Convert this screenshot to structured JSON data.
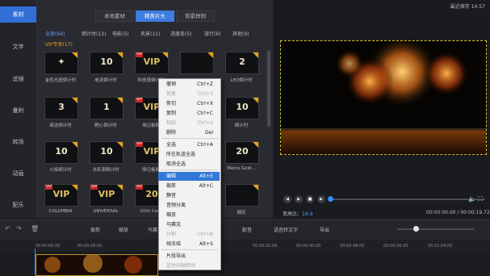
{
  "rail": {
    "items": [
      "素材",
      "文字",
      "滤镜",
      "叠附",
      "转场",
      "动画",
      "配乐"
    ]
  },
  "media": {
    "tabs": [
      "本地素材",
      "精美片头",
      "背景样例"
    ],
    "categories": [
      "全部(64)",
      "倒计时(13)",
      "电影(5)",
      "风景(11)",
      "进度条(5)",
      "旅行(6)",
      "其他(9)"
    ],
    "vip_label": "VIP专享(17)",
    "thumbnails": [
      {
        "label": "金色光斑倒计时",
        "glyph": "✦",
        "vip": false
      },
      {
        "label": "电流倒计时",
        "glyph": "10",
        "vip": false
      },
      {
        "label": "科技感倒计时",
        "glyph": "VIP",
        "vip": true
      },
      {
        "label": "",
        "glyph": "",
        "vip": false
      },
      {
        "label": "LED倒计时",
        "glyph": "2",
        "vip": false
      },
      {
        "label": "简洁倒计时",
        "glyph": "3",
        "vip": false
      },
      {
        "label": "靶心倒计时",
        "glyph": "1",
        "vip": false
      },
      {
        "label": "场记板倒",
        "glyph": "VIP",
        "vip": true
      },
      {
        "label": "",
        "glyph": "",
        "vip": false
      },
      {
        "label": "倒计时",
        "glyph": "10",
        "vip": false
      },
      {
        "label": "火焰倒计时",
        "glyph": "10",
        "vip": false
      },
      {
        "label": "水彩滴倒计时",
        "glyph": "10",
        "vip": false
      },
      {
        "label": "场记板倒",
        "glyph": "VIP",
        "vip": true
      },
      {
        "label": "",
        "glyph": "",
        "vip": false
      },
      {
        "label": "Metro Gold...",
        "glyph": "20",
        "vip": false
      },
      {
        "label": "COLUMBIA",
        "glyph": "VIP",
        "vip": true
      },
      {
        "label": "UNIVERSAL",
        "glyph": "VIP",
        "vip": true
      },
      {
        "label": "20th Cent",
        "glyph": "20",
        "vip": true
      },
      {
        "label": "",
        "glyph": "",
        "vip": false
      },
      {
        "label": "烟花",
        "glyph": "",
        "vip": false
      }
    ]
  },
  "preview": {
    "autosave": "最近保存 14:57",
    "aspect": "宽高比：",
    "aspect_value": "16:9",
    "time": "00:00:00.00 / 00:00:19.72",
    "progress": 0.0
  },
  "timeline": {
    "tools": [
      "裁剪",
      "缩放",
      "马赛克",
      "配音",
      "语音转文字",
      "导出"
    ],
    "ticks": [
      "00:00:00.00",
      "00:00:08.00",
      "00:00:32.00",
      "00:00:40.00",
      "00:00:48.00",
      "00:00:56.00",
      "00:01:04.00"
    ]
  },
  "context_menu": {
    "items": [
      {
        "label": "撤销",
        "shortcut": "Ctrl+Z",
        "disabled": false
      },
      {
        "label": "恢复",
        "shortcut": "Ctrl+Y",
        "disabled": true
      },
      {
        "label": "剪切",
        "shortcut": "Ctrl+X",
        "disabled": false
      },
      {
        "label": "复制",
        "shortcut": "Ctrl+C",
        "disabled": false
      },
      {
        "label": "粘贴",
        "shortcut": "Ctrl+V",
        "disabled": true
      },
      {
        "label": "删除",
        "shortcut": "Del",
        "disabled": false
      },
      {
        "label": "全选",
        "shortcut": "Ctrl+A",
        "disabled": false
      },
      {
        "label": "所在轨道全选",
        "shortcut": "",
        "disabled": false
      },
      {
        "label": "取消全选",
        "shortcut": "",
        "disabled": false
      },
      {
        "label": "编辑",
        "shortcut": "Alt+E",
        "disabled": false,
        "highlighted": true
      },
      {
        "label": "裁剪",
        "shortcut": "Alt+C",
        "disabled": false
      },
      {
        "label": "静音",
        "shortcut": "",
        "disabled": false
      },
      {
        "label": "音频分离",
        "shortcut": "",
        "disabled": false
      },
      {
        "label": "缩放",
        "shortcut": "",
        "disabled": false
      },
      {
        "label": "马赛克",
        "shortcut": "",
        "disabled": false
      },
      {
        "label": "分割",
        "shortcut": "Ctrl+B",
        "disabled": true
      },
      {
        "label": "帧冻结",
        "shortcut": "Alt+S",
        "disabled": false
      },
      {
        "label": "片段导出",
        "shortcut": "",
        "disabled": false
      },
      {
        "label": "定时间轴移动",
        "shortcut": "",
        "disabled": true
      }
    ]
  },
  "colors": {
    "accent": "#3d7ce0",
    "vip": "#e0a020",
    "highlight": "#3279d8"
  }
}
